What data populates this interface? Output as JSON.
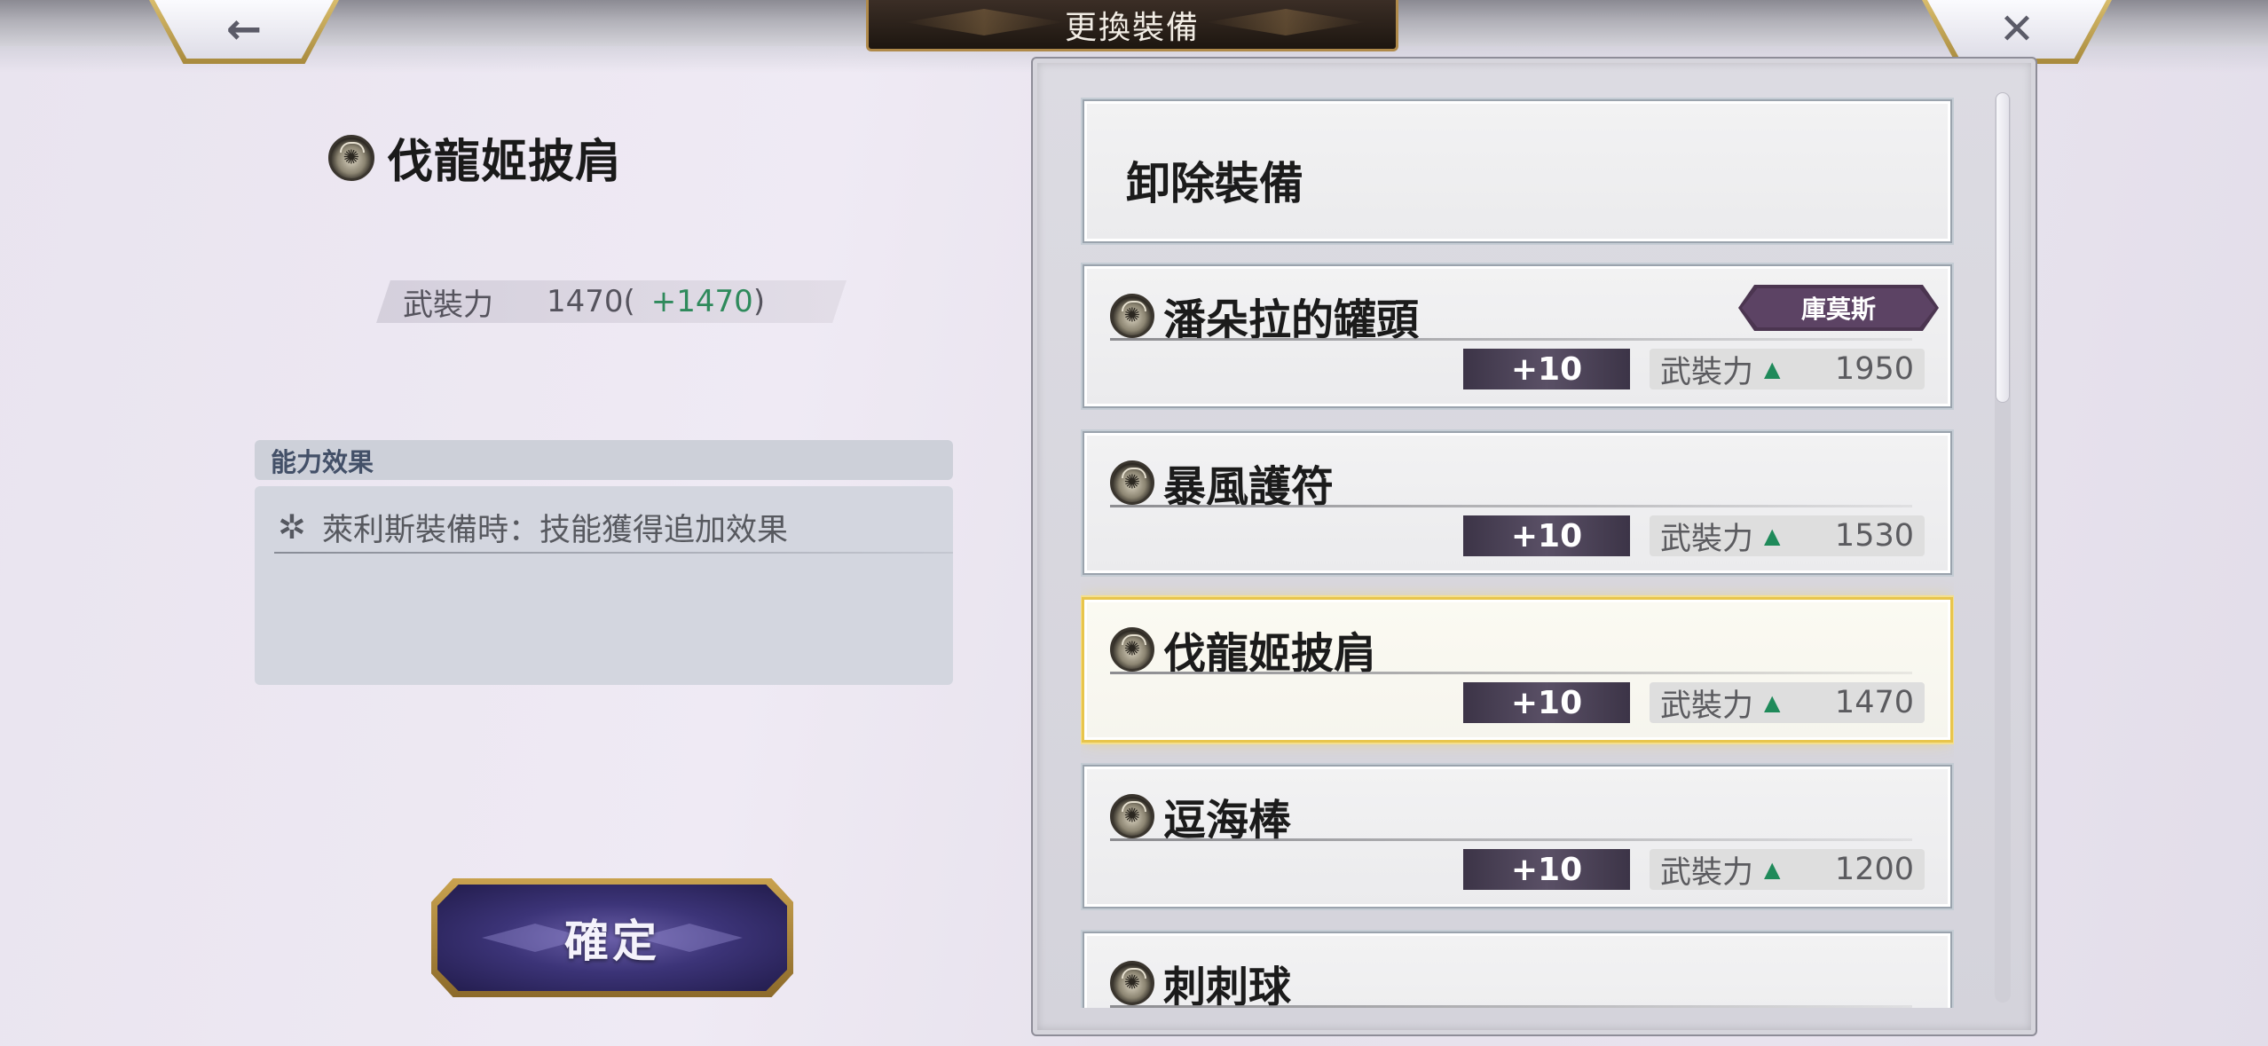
{
  "header": {
    "title": "更換裝備",
    "back_icon": "←",
    "close_icon": "✕"
  },
  "selected_equipment": {
    "name": "伐龍姬披肩",
    "power_label": "武裝力",
    "power_value": "1470(",
    "power_bonus": "+1470",
    "power_close": ")"
  },
  "ability": {
    "header": "能力效果",
    "line": "萊利斯裝備時：技能獲得追加效果"
  },
  "confirm_label": "確定",
  "list": {
    "unequip_label": "卸除裝備",
    "items": [
      {
        "name": "潘朵拉的罐頭",
        "tag": "庫莫斯",
        "plus": "+10",
        "power_label": "武裝力",
        "power": "1950",
        "selected": false
      },
      {
        "name": "暴風護符",
        "tag": "",
        "plus": "+10",
        "power_label": "武裝力",
        "power": "1530",
        "selected": false
      },
      {
        "name": "伐龍姬披肩",
        "tag": "",
        "plus": "+10",
        "power_label": "武裝力",
        "power": "1470",
        "selected": true
      },
      {
        "name": "逗海棒",
        "tag": "",
        "plus": "+10",
        "power_label": "武裝力",
        "power": "1200",
        "selected": false
      },
      {
        "name": "刺刺球",
        "tag": "",
        "plus": "",
        "power_label": "",
        "power": "",
        "selected": false
      }
    ]
  },
  "colors": {
    "bonus_green": "#2f8a5c",
    "tag_purple": "#4b3550",
    "selected_gold": "#e8c54c",
    "confirm_purple": "#3c3478"
  }
}
